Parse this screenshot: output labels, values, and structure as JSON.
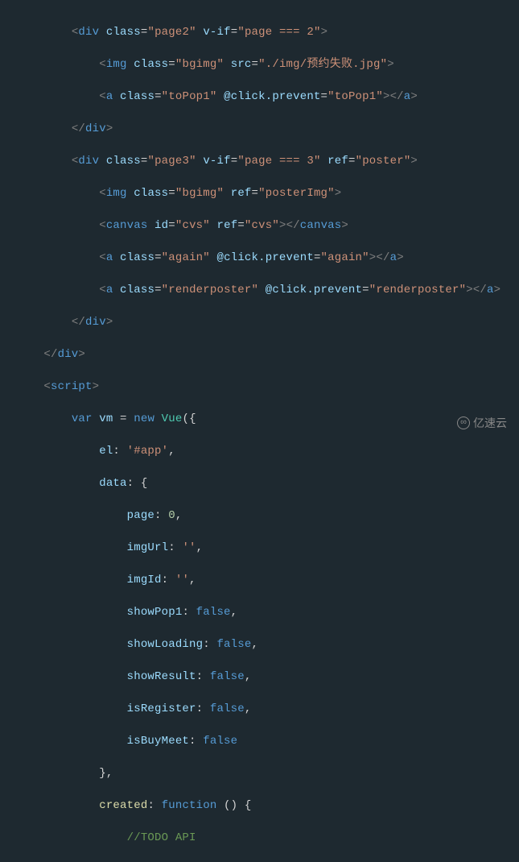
{
  "indent": {
    "i2": "        ",
    "i3": "            ",
    "i4": "                ",
    "i1": "    ",
    "i35": "              "
  },
  "sym": {
    "lt": "<",
    "gt": ">",
    "lte": "</",
    "eq": "=",
    "q": "\"",
    "ob": "{",
    "cb": "}",
    "op": "(",
    "cp": ")",
    "col": ": ",
    "com": ",",
    "assign": " = "
  },
  "tags": {
    "div": "div",
    "img": "img",
    "a": "a",
    "canvas": "canvas",
    "script": "script"
  },
  "attrs": {
    "class": "class",
    "vif": "v-if",
    "src": "src",
    "clickPrevent": "@click.prevent",
    "ref": "ref",
    "id": "id"
  },
  "vals": {
    "page2": "page2",
    "page3": "page3",
    "pageEq2": "page === 2",
    "pageEq3": "page === 3",
    "bgimg": "bgimg",
    "srcFail": "./img/预约失败.jpg",
    "toPop1": "toPop1",
    "poster": "poster",
    "posterImg": "posterImg",
    "cvs": "cvs",
    "again": "again",
    "renderposter": "renderposter"
  },
  "js": {
    "var": "var",
    "vm": "vm",
    "new": "new",
    "Vue": "Vue",
    "el": "el",
    "elVal": "'#app'",
    "data": "data",
    "page": "page",
    "pageVal": "0",
    "imgUrl": "imgUrl",
    "emptyStr": "''",
    "imgId": "imgId",
    "showPop1": "showPop1",
    "showLoading": "showLoading",
    "showResult": "showResult",
    "isRegister": "isRegister",
    "isBuyMeet": "isBuyMeet",
    "false": "false",
    "created": "created",
    "function": "function",
    "funcArgs": " () ",
    "todoComment": "//TODO API"
  },
  "watermark": {
    "icon": "∞",
    "text": "亿速云"
  }
}
